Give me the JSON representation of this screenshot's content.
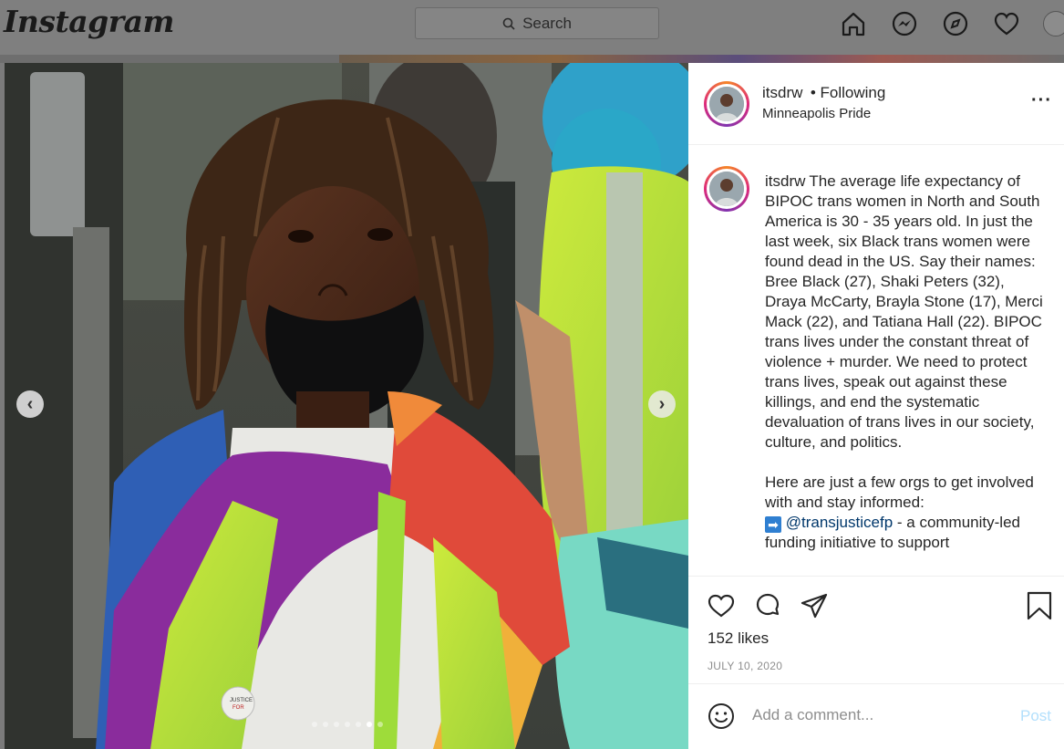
{
  "nav": {
    "logo": "Instagram",
    "search_placeholder": "Search",
    "icons": [
      "home-icon",
      "messenger-icon",
      "explore-icon",
      "heart-icon",
      "avatar"
    ]
  },
  "post": {
    "carousel": {
      "total": 7,
      "active_index": 5
    },
    "author": {
      "username": "itsdrw",
      "follow_status": "• Following",
      "location": "Minneapolis Pride"
    },
    "caption": {
      "username": "itsdrw",
      "text": "The average life expectancy of BIPOC trans women in North and South America is 30 - 35 years old. In just the last week, six Black trans women were found dead in the US. Say their names: Bree Black (27), Shaki Peters (32), Draya McCarty, Brayla Stone (17), Merci Mack (22), and Tatiana Hall (22). BIPOC trans lives under the constant threat of violence + murder. We need to protect trans lives, speak out against these killings, and end the systematic devaluation of trans lives in our society, culture, and politics.",
      "text2": "Here are just a few orgs to get involved with and stay informed:",
      "arrow": "➡",
      "mention": "@transjusticefp",
      "text3": " - a community-led funding initiative to support"
    },
    "likes": "152 likes",
    "date": "JULY 10, 2020",
    "comment_placeholder": "Add a comment...",
    "post_label": "Post"
  },
  "colors": {
    "accent_link": "#00376b",
    "post_button_disabled": "#b2dffc"
  }
}
